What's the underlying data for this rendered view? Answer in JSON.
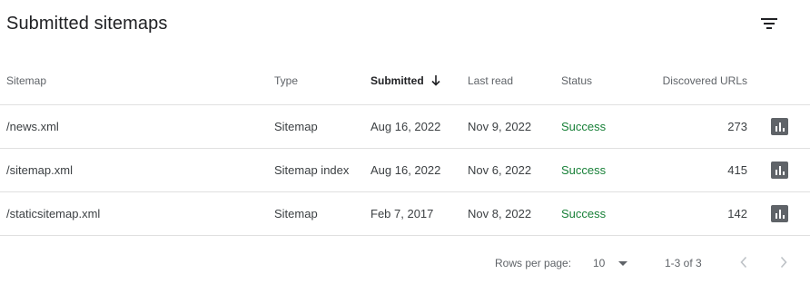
{
  "card": {
    "title": "Submitted sitemaps",
    "filter_icon": "filter-list-icon"
  },
  "table": {
    "columns": {
      "sitemap": "Sitemap",
      "type": "Type",
      "submitted": "Submitted",
      "last_read": "Last read",
      "status": "Status",
      "discovered_urls": "Discovered URLs"
    },
    "sorted_by": "submitted",
    "sort_direction": "descending",
    "rows": [
      {
        "sitemap": "/news.xml",
        "type": "Sitemap",
        "submitted": "Aug 16, 2022",
        "last_read": "Nov 9, 2022",
        "status": "Success",
        "discovered_urls": "273"
      },
      {
        "sitemap": "/sitemap.xml",
        "type": "Sitemap index",
        "submitted": "Aug 16, 2022",
        "last_read": "Nov 6, 2022",
        "status": "Success",
        "discovered_urls": "415"
      },
      {
        "sitemap": "/staticsitemap.xml",
        "type": "Sitemap",
        "submitted": "Feb 7, 2017",
        "last_read": "Nov 8, 2022",
        "status": "Success",
        "discovered_urls": "142"
      }
    ],
    "row_action_icon": "bar-chart-icon"
  },
  "pagination": {
    "rows_per_page_label": "Rows per page:",
    "rows_per_page_value": "10",
    "range_text": "1-3 of 3",
    "prev_icon": "chevron-left-icon",
    "next_icon": "chevron-right-icon"
  },
  "colors": {
    "success": "#188038",
    "icon": "#5f6368",
    "divider": "#e0e0e0"
  }
}
